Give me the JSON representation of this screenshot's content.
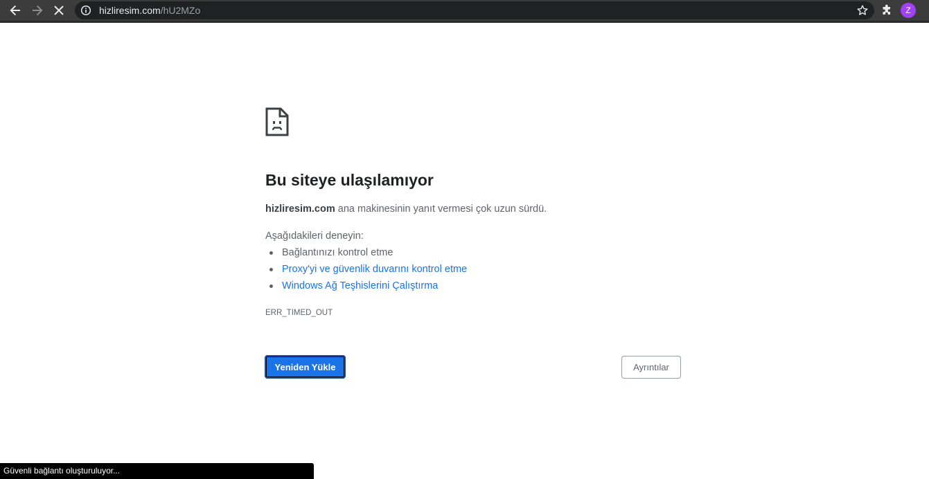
{
  "browser": {
    "url_host": "hizliresim.com",
    "url_path": "/hU2MZo",
    "profile_initial": "Z",
    "accent": "#a142f4"
  },
  "icons": {
    "back": "arrow-left-icon",
    "forward": "arrow-right-icon",
    "stop": "close-icon",
    "info": "info-icon",
    "bookmark": "star-icon",
    "extensions": "puzzle-icon",
    "error": "sad-page-icon"
  },
  "error": {
    "title": "Bu siteye ulaşılamıyor",
    "host": "hizliresim.com",
    "desc_rest": " ana makinesinin yanıt vermesi çok uzun sürdü.",
    "try_heading": "Aşağıdakileri deneyin:",
    "suggestions": [
      "Bağlantınızı kontrol etme",
      "Proxy'yi ve güvenlik duvarını kontrol etme",
      "Windows Ağ Teşhislerini Çalıştırma"
    ],
    "code": "ERR_TIMED_OUT",
    "reload_label": "Yeniden Yükle",
    "details_label": "Ayrıntılar",
    "link_color": "#1a73e8",
    "button_color": "#1a73e8"
  },
  "status_text": "Güvenli bağlantı oluşturuluyor..."
}
